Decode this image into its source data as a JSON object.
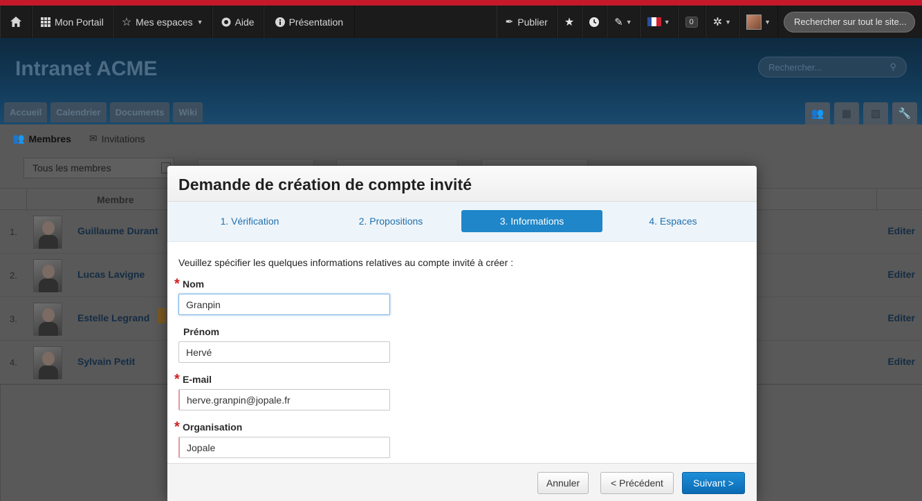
{
  "navbar": {
    "home_icon": "home-icon",
    "items": [
      {
        "label": "Mon Portail",
        "icon": "grid-icon"
      },
      {
        "label": "Mes espaces",
        "icon": "star-outline-icon"
      },
      {
        "label": "Aide",
        "icon": "lifebuoy-icon"
      },
      {
        "label": "Présentation",
        "icon": "info-icon"
      }
    ],
    "publish_label": "Publier",
    "notif_count": "0",
    "search_placeholder": "Rechercher sur tout le site..."
  },
  "site": {
    "title": "Intranet ACME",
    "search_placeholder": "Rechercher...",
    "tabs": [
      "Accueil",
      "Calendrier",
      "Documents",
      "Wiki"
    ]
  },
  "page": {
    "subtabs": [
      "Membres",
      "Invitations"
    ],
    "filter_value": "Tous les membres",
    "column_member": "Membre",
    "rows": [
      {
        "index": "1.",
        "name": "Guillaume Durant",
        "action": "Editer"
      },
      {
        "index": "2.",
        "name": "Lucas Lavigne",
        "action": "Editer"
      },
      {
        "index": "3.",
        "name": "Estelle Legrand",
        "action": "Editer"
      },
      {
        "index": "4.",
        "name": "Sylvain Petit",
        "action": "Editer"
      }
    ]
  },
  "modal": {
    "title": "Demande de création de compte invité",
    "steps": [
      "1. Vérification",
      "2. Propositions",
      "3. Informations",
      "4. Espaces"
    ],
    "active_step": 2,
    "intro": "Veuillez spécifier les quelques informations relatives au compte invité à créer :",
    "fields": [
      {
        "label": "Nom",
        "value": "Granpin",
        "required": true
      },
      {
        "label": "Prénom",
        "value": "Hervé",
        "required": false
      },
      {
        "label": "E-mail",
        "value": "herve.granpin@jopale.fr",
        "required": true
      },
      {
        "label": "Organisation",
        "value": "Jopale",
        "required": true
      }
    ],
    "buttons": {
      "cancel": "Annuler",
      "previous": "< Précédent",
      "next": "Suivant >"
    }
  },
  "colors": {
    "brand_red": "#c5182a",
    "navbar_bg": "#1b1b1b",
    "primary_blue": "#1e86c9",
    "required_star": "#d21f1f"
  }
}
